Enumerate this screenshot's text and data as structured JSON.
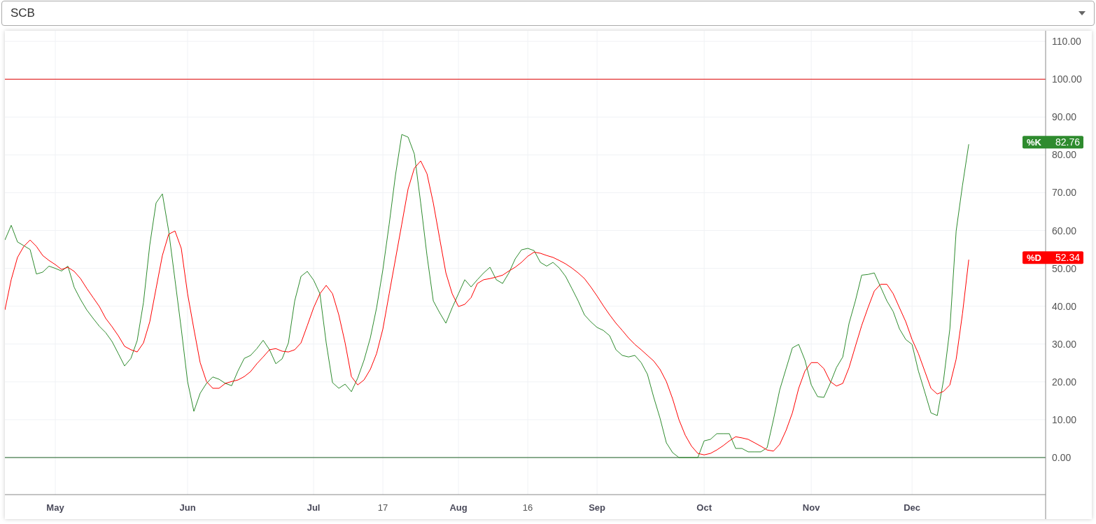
{
  "select": {
    "value": "SCB"
  },
  "chart": {
    "chart_data": {
      "type": "line",
      "categories": [
        null,
        null,
        null,
        null,
        null,
        null,
        null,
        null,
        "May",
        null,
        null,
        null,
        null,
        null,
        null,
        null,
        null,
        null,
        null,
        null,
        null,
        null,
        null,
        null,
        null,
        null,
        null,
        null,
        null,
        "Jun",
        null,
        null,
        null,
        null,
        null,
        null,
        null,
        null,
        null,
        null,
        null,
        null,
        null,
        null,
        null,
        null,
        null,
        null,
        null,
        "Jul",
        null,
        null,
        null,
        null,
        null,
        null,
        null,
        null,
        null,
        null,
        "17",
        null,
        null,
        null,
        null,
        null,
        null,
        null,
        null,
        null,
        null,
        null,
        "Aug",
        null,
        null,
        null,
        null,
        null,
        null,
        null,
        null,
        null,
        null,
        "16",
        null,
        null,
        null,
        null,
        null,
        null,
        null,
        null,
        null,
        null,
        "Sep",
        null,
        null,
        null,
        null,
        null,
        null,
        null,
        null,
        null,
        null,
        null,
        null,
        null,
        null,
        null,
        null,
        "Oct",
        null,
        null,
        null,
        null,
        null,
        null,
        null,
        null,
        null,
        null,
        null,
        null,
        null,
        null,
        null,
        null,
        "Nov",
        null,
        null,
        null,
        null,
        null,
        null,
        null,
        null,
        null,
        null,
        null,
        null,
        null,
        null,
        null,
        "Dec",
        null,
        null,
        null,
        null,
        null,
        null,
        null,
        null,
        null
      ],
      "grid": true,
      "ylim": [
        -9.8,
        112.8
      ],
      "yticks": [
        {
          "value": 0,
          "label": "0.00"
        },
        {
          "value": 10,
          "label": "10.00"
        },
        {
          "value": 20,
          "label": "20.00"
        },
        {
          "value": 30,
          "label": "30.00"
        },
        {
          "value": 40,
          "label": "40.00"
        },
        {
          "value": 50,
          "label": "50.00"
        },
        {
          "value": 60,
          "label": "60.00"
        },
        {
          "value": 70,
          "label": "70.00"
        },
        {
          "value": 80,
          "label": "80.00"
        },
        {
          "value": 90,
          "label": "90.00"
        },
        {
          "value": 100,
          "label": "100.00"
        },
        {
          "value": 110,
          "label": "110.00"
        }
      ],
      "series": [
        {
          "name": "%K",
          "color": "#2e8b2e",
          "values": [
            57.5,
            61.4,
            57,
            56,
            55,
            48.5,
            49,
            50.6,
            50,
            49.3,
            50.6,
            45,
            41.8,
            39,
            36.8,
            34.7,
            33,
            30.7,
            27.5,
            24.2,
            26.2,
            30.9,
            41,
            56.2,
            67.3,
            69.7,
            59.9,
            47,
            34,
            20.1,
            12.2,
            17,
            19.6,
            21.3,
            20.7,
            19.6,
            19,
            22.9,
            26.2,
            27,
            28.8,
            31,
            28.5,
            24.8,
            26.1,
            30.3,
            41.4,
            47.9,
            49.2,
            46.9,
            43.3,
            30.3,
            19.8,
            18.3,
            19.4,
            17.4,
            21,
            25.7,
            31.6,
            39.6,
            49.7,
            61.7,
            74.7,
            85.4,
            84.7,
            80.2,
            67.3,
            53.4,
            41.4,
            38.3,
            35.5,
            39.6,
            43.3,
            47,
            45.1,
            47,
            48.8,
            50.3,
            47,
            46,
            48.8,
            52.5,
            54.9,
            55.3,
            54.7,
            51.6,
            50.6,
            51.6,
            50.1,
            47.9,
            44.7,
            41.4,
            37.7,
            35.9,
            34.4,
            33.6,
            32.2,
            28.5,
            27,
            26.6,
            27,
            25.1,
            22,
            15.9,
            10.4,
            3.9,
            1.3,
            0,
            0,
            0,
            0,
            4.4,
            4.8,
            6.3,
            6.3,
            6.3,
            2.4,
            2.4,
            1.5,
            1.5,
            1.5,
            2.6,
            10,
            17.9,
            23.5,
            29,
            29.9,
            25.7,
            19.2,
            16.1,
            15.9,
            19.6,
            23.8,
            26.6,
            35.5,
            41.4,
            48.2,
            48.4,
            48.8,
            45.1,
            41.4,
            38.6,
            34,
            31.2,
            29.9,
            22.9,
            17.4,
            11.8,
            11.1,
            20.5,
            34,
            59.9,
            71.9,
            82.8
          ]
        },
        {
          "name": "%D",
          "color": "#ff0000",
          "values": [
            39,
            47,
            52.9,
            55.8,
            57.5,
            55.8,
            53.4,
            52.1,
            51,
            49.7,
            50.3,
            49.2,
            47.3,
            44.7,
            42.3,
            39.9,
            36.8,
            34.6,
            32.2,
            29.4,
            28.5,
            27.9,
            30.3,
            35.9,
            44.7,
            53.4,
            59,
            59.9,
            55.3,
            43.3,
            34,
            25.1,
            20.1,
            18.3,
            18.3,
            19.6,
            20.1,
            20.5,
            21.4,
            22.7,
            24.8,
            26.6,
            28.5,
            28.8,
            28.1,
            27.9,
            28.5,
            30.3,
            34.9,
            39.6,
            43.3,
            45.5,
            43.3,
            37.7,
            30.3,
            21.4,
            19.2,
            20.5,
            23.3,
            27.5,
            34,
            43.3,
            52.5,
            61.7,
            71,
            76.5,
            78.4,
            75,
            67.3,
            58,
            48.8,
            43.3,
            39.9,
            40.5,
            42.3,
            46,
            47,
            47.3,
            47.7,
            48.2,
            49.3,
            50.3,
            51.6,
            53.2,
            54.3,
            54,
            53.4,
            52.9,
            52.1,
            51.2,
            50.1,
            48.8,
            47.3,
            45.1,
            42.7,
            40.1,
            37.7,
            35.5,
            33.6,
            31.6,
            29.9,
            28.5,
            27,
            25.5,
            23.3,
            20.1,
            15.5,
            10,
            5.9,
            3,
            1.1,
            0.7,
            1.1,
            2,
            3.1,
            4.4,
            5.5,
            5.2,
            4.8,
            3.9,
            3,
            2,
            1.7,
            3.5,
            7.2,
            11.8,
            18.3,
            22.9,
            25.1,
            25.1,
            23.5,
            20.1,
            18.9,
            19.6,
            23.8,
            29.4,
            34.9,
            39.6,
            44,
            45.8,
            45.8,
            43.3,
            39.6,
            35.9,
            31.2,
            27.5,
            22.9,
            18.3,
            16.8,
            17.5,
            19.2,
            26,
            38,
            52.3
          ]
        }
      ],
      "ref_lines": [
        {
          "axis": "y",
          "value": 100,
          "color": "#e00000"
        },
        {
          "axis": "y",
          "value": 0,
          "color": "#1b5e20"
        }
      ]
    },
    "xtick_styles": [
      {
        "bold": true
      },
      {
        "bold": true
      },
      {
        "bold": true
      },
      {
        "bold": false
      },
      {
        "bold": true
      },
      {
        "bold": false
      },
      {
        "bold": true
      },
      {
        "bold": true
      },
      {
        "bold": true
      },
      {
        "bold": true
      }
    ],
    "value_tags": [
      {
        "text": "82.76"
      },
      {
        "text": "52.34"
      }
    ]
  }
}
